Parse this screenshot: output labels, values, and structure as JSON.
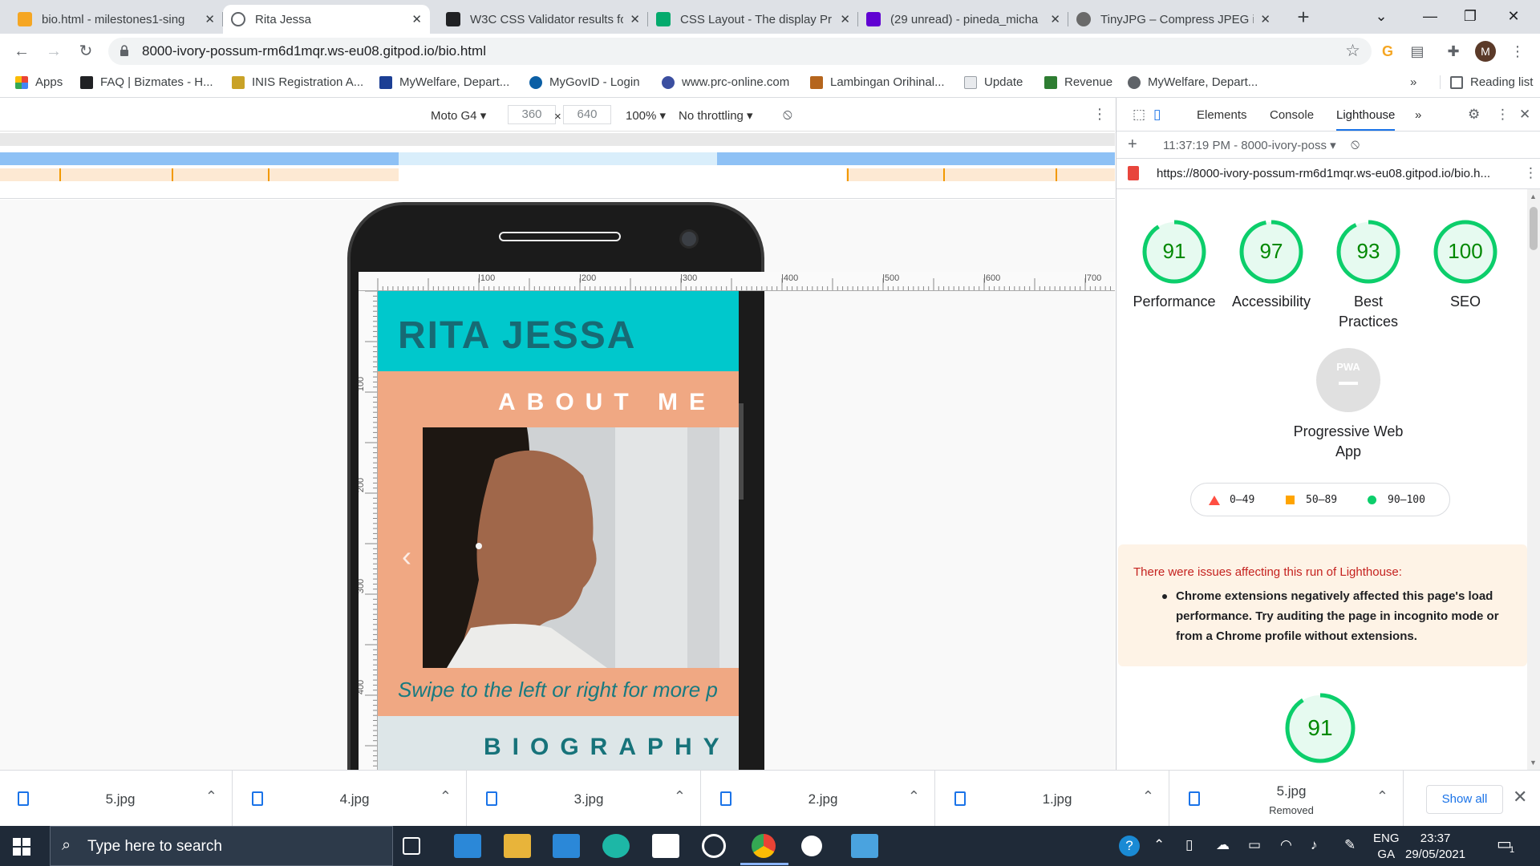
{
  "browser": {
    "tabs": [
      {
        "title": "bio.html - milestones1-sing",
        "favicon_color": "#f5a623"
      },
      {
        "title": "Rita Jessa",
        "favicon_color": "#5f6368"
      },
      {
        "title": "W3C CSS Validator results fo",
        "favicon_color": "#202124"
      },
      {
        "title": "CSS Layout - The display Pr",
        "favicon_color": "#04aa6d"
      },
      {
        "title": "(29 unread) - pineda_micha",
        "favicon_color": "#6001d2"
      },
      {
        "title": "TinyJPG – Compress JPEG in",
        "favicon_color": "#6a6a6a"
      }
    ],
    "new_tab": "+",
    "url": "8000-ivory-possum-rm6d1mqr.ws-eu08.gitpod.io/bio.html",
    "avatar_letter": "M",
    "bookmarks": [
      {
        "label": "Apps",
        "color": "#ea4335"
      },
      {
        "label": "FAQ | Bizmates - H...",
        "color": "#202124"
      },
      {
        "label": "INIS Registration A...",
        "color": "#c9a227"
      },
      {
        "label": "MyWelfare, Depart...",
        "color": "#1c3f94"
      },
      {
        "label": "MyGovID - Login",
        "color": "#0b5fa5"
      },
      {
        "label": "www.prc-online.com",
        "color": "#3b4fa0"
      },
      {
        "label": "Lambingan Orihinal...",
        "color": "#b5651d"
      },
      {
        "label": "Update",
        "color": "#9aa0a6"
      },
      {
        "label": "Revenue",
        "color": "#2e7d32"
      },
      {
        "label": "MyWelfare, Depart...",
        "color": "#5f6368"
      }
    ],
    "more_bookmarks": "»",
    "reading_list": "Reading list"
  },
  "device_toolbar": {
    "device": "Moto G4 ▾",
    "width": "360",
    "height": "640",
    "times": "×",
    "zoom": "100% ▾",
    "throttling": "No throttling ▾"
  },
  "site": {
    "title": "RITA JESSA",
    "about_heading": "ABOUT ME",
    "swipe_text": "Swipe to the left or right for more p",
    "bio_heading": "BIOGRAPHY",
    "prev_arrow": "‹"
  },
  "rulers": {
    "h_ticks": [
      "|100",
      "|200",
      "|300",
      "|400",
      "|500",
      "|600",
      "|700"
    ],
    "v_ticks": [
      "100",
      "200",
      "300",
      "400"
    ]
  },
  "devtools": {
    "tabs": [
      "Elements",
      "Console",
      "Lighthouse",
      "»"
    ],
    "session": "11:37:19 PM - 8000-ivory-poss ▾",
    "report_url": "https://8000-ivory-possum-rm6d1mqr.ws-eu08.gitpod.io/bio.h...",
    "scores": [
      {
        "label": "Performance",
        "value": "91",
        "score": 91
      },
      {
        "label": "Accessibility",
        "value": "97",
        "score": 97
      },
      {
        "label": "Best Practices",
        "value": "93",
        "score": 93
      },
      {
        "label": "SEO",
        "value": "100",
        "score": 100
      }
    ],
    "pwa_badge": "PWA",
    "pwa_label": "Progressive Web App",
    "legend": [
      {
        "range": "0–49",
        "color": "#ff4e42"
      },
      {
        "range": "50–89",
        "color": "#ffa400"
      },
      {
        "range": "90–100",
        "color": "#0cce6b"
      }
    ],
    "warning_title": "There were issues affecting this run of Lighthouse:",
    "warning_text": "Chrome extensions negatively affected this page's load performance. Try auditing the page in incognito mode or from a Chrome profile without extensions.",
    "main_score": {
      "value": "91",
      "score": 91
    },
    "colors": {
      "good": "#0cce6b",
      "good_text": "#008800",
      "good_bg": "#e6faf0"
    }
  },
  "downloads": {
    "items": [
      {
        "name": "5.jpg",
        "status": ""
      },
      {
        "name": "4.jpg",
        "status": ""
      },
      {
        "name": "3.jpg",
        "status": ""
      },
      {
        "name": "2.jpg",
        "status": ""
      },
      {
        "name": "1.jpg",
        "status": ""
      },
      {
        "name": "5.jpg",
        "status": "Removed"
      }
    ],
    "show_all": "Show all"
  },
  "taskbar": {
    "search_placeholder": "Type here to search",
    "lang_top": "ENG",
    "lang_bottom": "GA",
    "time": "23:37",
    "date": "29/05/2021",
    "notification_count": "1"
  }
}
